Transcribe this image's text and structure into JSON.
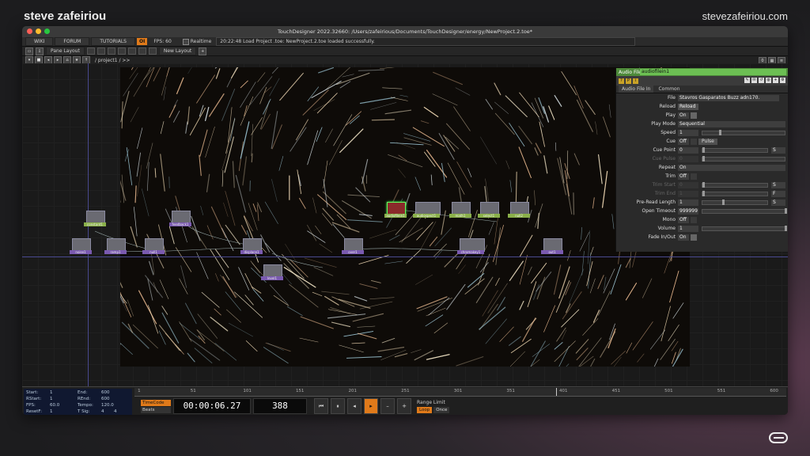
{
  "brand": {
    "left": "steve zafeiriou",
    "right": "stevezafeiriou.com"
  },
  "window": {
    "title": "TouchDesigner 2022.32660: /Users/zafeirious/Documents/TouchDesigner/energy/NewProject.2.toe*",
    "traffic_colors": [
      "#ff5f57",
      "#febc2e",
      "#28c840"
    ]
  },
  "menubar": {
    "wiki": "WIKI",
    "forum": "FORUM",
    "tutorials": "TUTORIALS",
    "oi": "OI",
    "fps_label": "FPS:",
    "fps_value": "60",
    "realtime": "Realtime",
    "status": "20:22:48 Load Project .toe: NewProject.2.toe loaded successfully."
  },
  "toolbar": {
    "pane_layout": "Pane Layout",
    "new_layout": "New Layout",
    "add": "+"
  },
  "pathbar": {
    "path": "/ project1 / >>",
    "zero": "0"
  },
  "params": {
    "header": "Audio File In",
    "name": "audiofilein1",
    "tabs": [
      "Audio File In",
      "Common"
    ],
    "rows": [
      {
        "label": "File",
        "value": "Stavros Gasparatos Buzz  adn170.",
        "type": "text"
      },
      {
        "label": "Reload",
        "value": "Reload",
        "type": "button"
      },
      {
        "label": "Play",
        "value": "On",
        "type": "toggle"
      },
      {
        "label": "Play Mode",
        "value": "Sequential",
        "type": "menu"
      },
      {
        "label": "Speed",
        "value": "1",
        "type": "slider",
        "pos": 0.2
      },
      {
        "label": "Cue",
        "value": "Off",
        "extra": "Pulse",
        "type": "toggle"
      },
      {
        "label": "Cue Point",
        "value": "0",
        "unit": "S",
        "type": "slider",
        "pos": 0.0
      },
      {
        "label": "Cue Pulse",
        "value": "0",
        "type": "slider",
        "pos": 0.0,
        "dim": true
      },
      {
        "label": "Repeat",
        "value": "On",
        "type": "menu"
      },
      {
        "label": "Trim",
        "value": "Off",
        "type": "toggle"
      },
      {
        "label": "Trim Start",
        "value": "0",
        "unit": "S",
        "type": "slider",
        "pos": 0.0,
        "dim": true
      },
      {
        "label": "Trim End",
        "value": "1",
        "unit": "F",
        "type": "slider",
        "pos": 0.0,
        "dim": true
      },
      {
        "label": "Pre-Read Length",
        "value": "1",
        "unit": "S",
        "type": "slider",
        "pos": 0.3
      },
      {
        "label": "Open Timeout",
        "value": "999999",
        "type": "slider",
        "pos": 1.0
      },
      {
        "label": "Mono",
        "value": "Off",
        "type": "toggle"
      },
      {
        "label": "Volume",
        "value": "1",
        "type": "slider",
        "pos": 1.0
      },
      {
        "label": "Fade In/Out",
        "value": "On",
        "type": "toggle"
      }
    ]
  },
  "nodes": [
    {
      "name": "constant1",
      "kind": "chop",
      "sel": false
    },
    {
      "name": "noise1",
      "kind": "top",
      "sel": false
    },
    {
      "name": "ramp1",
      "kind": "top",
      "sel": false
    },
    {
      "name": "null1",
      "kind": "top",
      "sel": false
    },
    {
      "name": "audiofilein1",
      "kind": "chop",
      "sel": true
    },
    {
      "name": "audiospect1",
      "kind": "chop",
      "sel": false
    },
    {
      "name": "math1",
      "kind": "chop",
      "sel": false
    },
    {
      "name": "select1",
      "kind": "chop",
      "sel": false
    },
    {
      "name": "null2",
      "kind": "chop",
      "sel": false
    },
    {
      "name": "feedback1",
      "kind": "top",
      "sel": false
    },
    {
      "name": "displace1",
      "kind": "top",
      "sel": false
    },
    {
      "name": "level1",
      "kind": "top",
      "sel": false
    },
    {
      "name": "over1",
      "kind": "top",
      "sel": false
    },
    {
      "name": "chromakey1",
      "kind": "top",
      "sel": false
    },
    {
      "name": "out1",
      "kind": "top",
      "sel": false
    }
  ],
  "timeline": {
    "start_label": "Start:",
    "start": "1",
    "end_label": "End:",
    "end": "600",
    "rstart_label": "RStart:",
    "rstart": "1",
    "rend_label": "REnd:",
    "rend": "600",
    "fps_label": "FPS:",
    "fps": "60.0",
    "tempo_label": "Tempo:",
    "tempo": "120.0",
    "resetf_label": "ResetF:",
    "resetf": "1",
    "tsig_label": "T Sig:",
    "tsig_a": "4",
    "tsig_b": "4",
    "ticks": [
      "1",
      "51",
      "101",
      "151",
      "201",
      "251",
      "301",
      "351",
      "401",
      "451",
      "501",
      "551",
      "600"
    ],
    "timecode_tab": "TimeCode",
    "beats_tab": "Beats",
    "timecode": "00:00:06.27",
    "frame": "388",
    "range_limit": "Range Limit",
    "loop": "Loop",
    "once": "Once"
  }
}
